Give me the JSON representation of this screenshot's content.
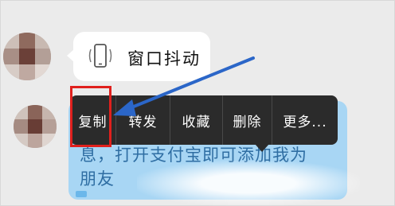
{
  "chat": {
    "incoming_message": {
      "icon": "phone-shake-icon",
      "text": "窗口抖动"
    },
    "highlighted_message": {
      "line1": "息，打开支付宝即可添加我为",
      "line2": "朋友"
    }
  },
  "context_menu": {
    "items": [
      {
        "label": "复制"
      },
      {
        "label": "转发"
      },
      {
        "label": "收藏"
      },
      {
        "label": "删除"
      },
      {
        "label": "更多..."
      }
    ]
  },
  "colors": {
    "menu_bg": "#2b2b2b",
    "annotation_red": "#e0201d",
    "arrow_blue": "#2b66c8",
    "bubble_blue": "#a8d6f4"
  }
}
